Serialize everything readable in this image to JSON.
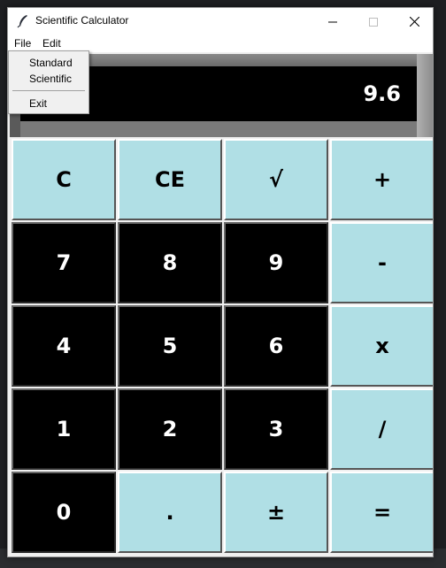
{
  "window": {
    "title": "Scientific Calculator"
  },
  "menubar": {
    "file": "File",
    "edit": "Edit"
  },
  "file_menu": {
    "standard": "Standard",
    "scientific": "Scientific",
    "exit": "Exit"
  },
  "display": {
    "value": "9.6"
  },
  "keys": [
    {
      "label": "C",
      "style": "light"
    },
    {
      "label": "CE",
      "style": "light"
    },
    {
      "label": "√",
      "style": "light"
    },
    {
      "label": "+",
      "style": "light"
    },
    {
      "label": "7",
      "style": "dark"
    },
    {
      "label": "8",
      "style": "dark"
    },
    {
      "label": "9",
      "style": "dark"
    },
    {
      "label": "-",
      "style": "light"
    },
    {
      "label": "4",
      "style": "dark"
    },
    {
      "label": "5",
      "style": "dark"
    },
    {
      "label": "6",
      "style": "dark"
    },
    {
      "label": "x",
      "style": "light"
    },
    {
      "label": "1",
      "style": "dark"
    },
    {
      "label": "2",
      "style": "dark"
    },
    {
      "label": "3",
      "style": "dark"
    },
    {
      "label": "/",
      "style": "light"
    },
    {
      "label": "0",
      "style": "dark"
    },
    {
      "label": ".",
      "style": "light"
    },
    {
      "label": "±",
      "style": "light"
    },
    {
      "label": "=",
      "style": "light"
    }
  ],
  "colors": {
    "light_key": "#b0dfe5",
    "dark_key": "#000000",
    "display_bg": "#000000"
  },
  "icons": {
    "app": "feather-icon",
    "minimize": "minimize-icon",
    "maximize": "maximize-icon",
    "close": "close-icon"
  }
}
